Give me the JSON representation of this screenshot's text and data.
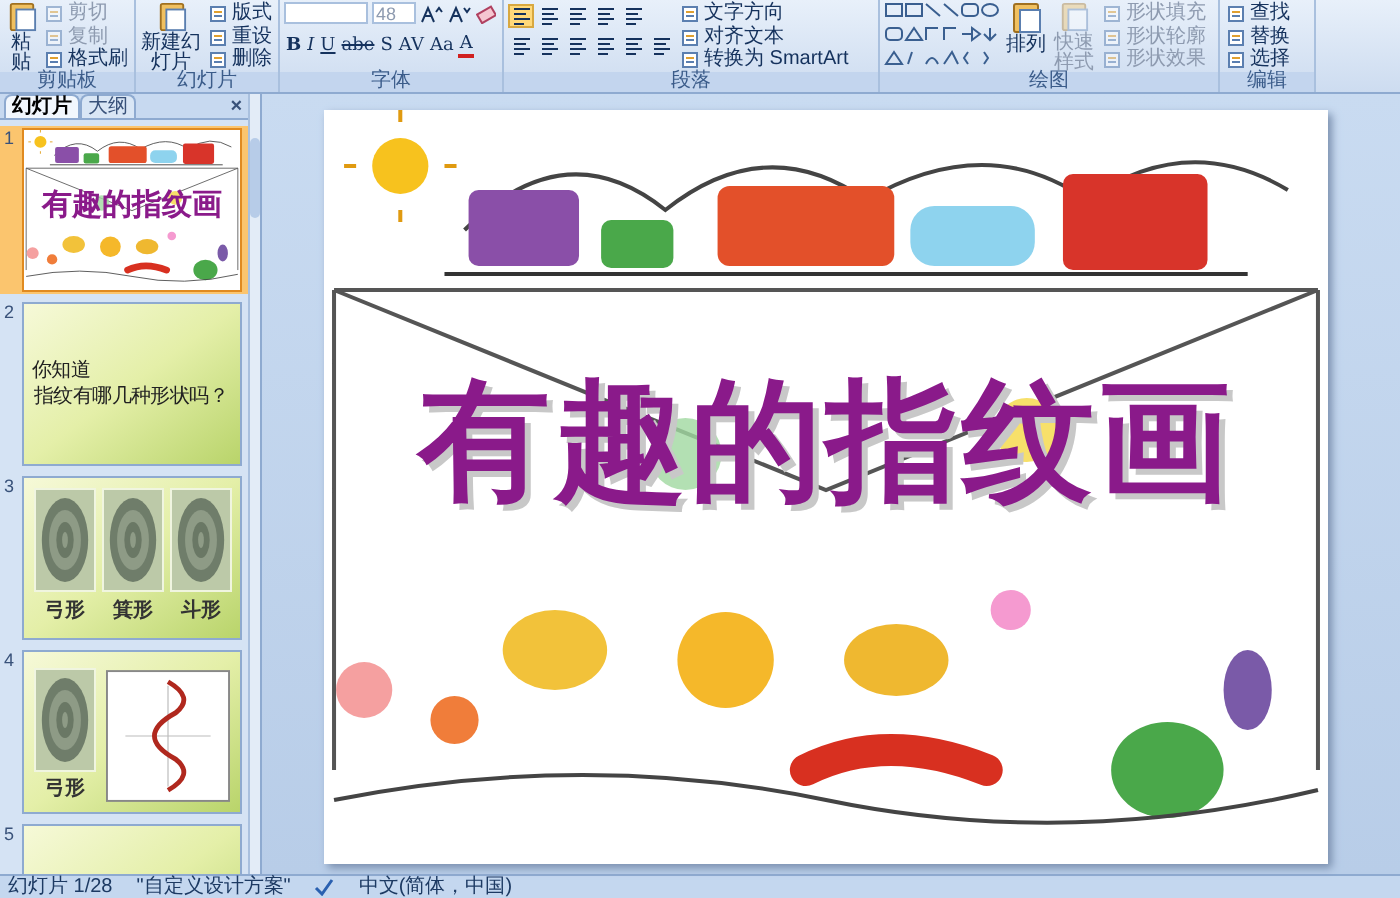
{
  "ribbon": {
    "groups": [
      {
        "label": "剪贴板",
        "kind": "clipboard",
        "large": [
          {
            "label": "粘贴",
            "disabled": false
          }
        ],
        "small": [
          {
            "label": "剪切",
            "disabled": true
          },
          {
            "label": "复制",
            "disabled": true
          },
          {
            "label": "格式刷",
            "disabled": false
          }
        ]
      },
      {
        "label": "幻灯片",
        "kind": "slides",
        "large": [
          {
            "label": "新建幻灯片",
            "disabled": false
          }
        ],
        "small": [
          {
            "label": "版式",
            "disabled": false
          },
          {
            "label": "重设",
            "disabled": false
          },
          {
            "label": "删除",
            "disabled": false
          }
        ]
      },
      {
        "label": "字体",
        "kind": "font",
        "font_size": "48",
        "format_buttons": [
          "B",
          "I",
          "U",
          "abe",
          "S",
          "AV",
          "Aa",
          "A"
        ]
      },
      {
        "label": "段落",
        "kind": "paragraph",
        "small": [
          {
            "label": "文字方向",
            "disabled": false
          },
          {
            "label": "对齐文本",
            "disabled": false
          },
          {
            "label": "转换为 SmartArt",
            "disabled": false
          }
        ]
      },
      {
        "label": "绘图",
        "kind": "drawing",
        "large": [
          {
            "label": "排列",
            "disabled": false
          },
          {
            "label": "快速样式",
            "disabled": true
          }
        ],
        "small": [
          {
            "label": "形状填充",
            "disabled": true
          },
          {
            "label": "形状轮廓",
            "disabled": true
          },
          {
            "label": "形状效果",
            "disabled": true
          }
        ]
      },
      {
        "label": "编辑",
        "kind": "editing",
        "small": [
          {
            "label": "查找",
            "disabled": false
          },
          {
            "label": "替换",
            "disabled": false
          },
          {
            "label": "选择",
            "disabled": false
          }
        ]
      }
    ]
  },
  "pane": {
    "tabs": [
      {
        "label": "幻灯片",
        "selected": true
      },
      {
        "label": "大纲",
        "selected": false
      }
    ],
    "close": "×",
    "slides": [
      {
        "number": "1",
        "selected": true,
        "kind": "title",
        "title": "有趣的指纹画"
      },
      {
        "number": "2",
        "selected": false,
        "kind": "text",
        "lines": [
          "你知道",
          "指纹有哪几种形状吗？"
        ]
      },
      {
        "number": "3",
        "selected": false,
        "kind": "prints",
        "labels": [
          "弓形",
          "箕形",
          "斗形"
        ]
      },
      {
        "number": "4",
        "selected": false,
        "kind": "print_diagram",
        "labels": [
          "弓形"
        ]
      },
      {
        "number": "5",
        "selected": false,
        "kind": "partial"
      }
    ]
  },
  "slide": {
    "title": "有趣的指纹画"
  },
  "status_bar": {
    "slide": "幻灯片 1/28",
    "theme": "\"自定义设计方案\"",
    "language": "中文(简体，中国)"
  }
}
